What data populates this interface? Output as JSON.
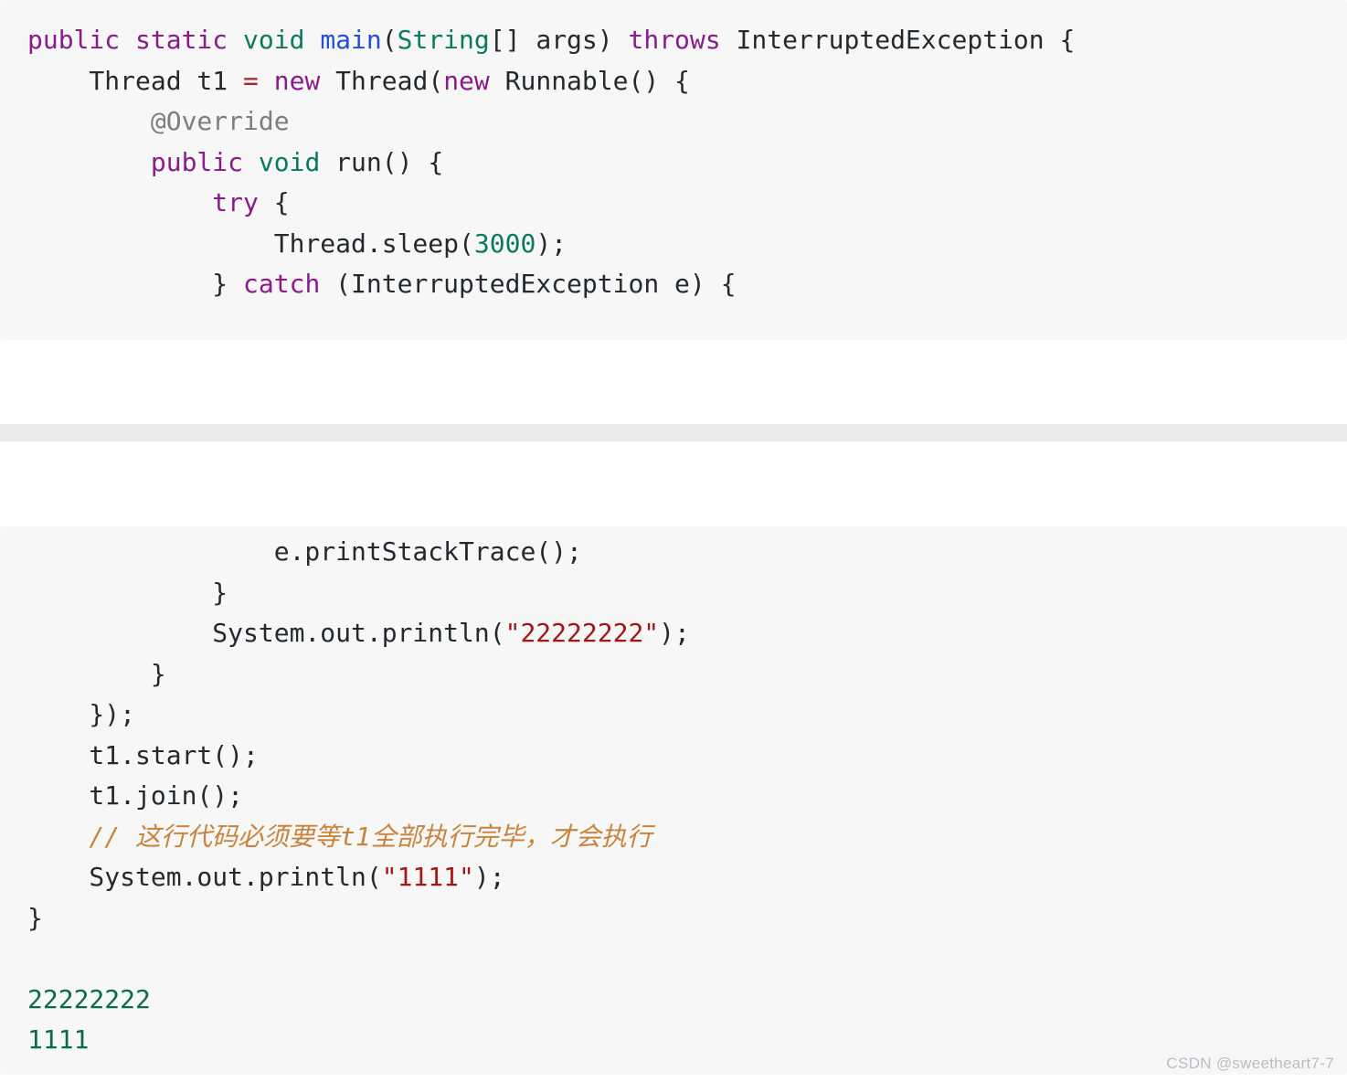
{
  "page": {
    "language": "java",
    "background": "#ffffff",
    "code_block_background": "#f7f7f7",
    "divider_background": "#ebebeb"
  },
  "colors": {
    "keyword": "#8b1a8b",
    "type": "#0a7a5e",
    "function": "#2050d8",
    "operator": "#a4262c",
    "annotation": "#7d7d7d",
    "string": "#a41515",
    "comment": "#c8843c",
    "plain": "#24292e",
    "output": "#0a6b4a",
    "watermark": "#b9bdc2"
  },
  "block_one": {
    "lines": [
      {
        "tokens": [
          {
            "t": "public static ",
            "c": "kw"
          },
          {
            "t": "void ",
            "c": "typ"
          },
          {
            "t": "main",
            "c": "fn"
          },
          {
            "t": "(",
            "c": "plain"
          },
          {
            "t": "String",
            "c": "typ"
          },
          {
            "t": "[] args) ",
            "c": "plain"
          },
          {
            "t": "throws ",
            "c": "kw"
          },
          {
            "t": "InterruptedException {",
            "c": "plain"
          }
        ]
      },
      {
        "tokens": [
          {
            "t": "    Thread t1 ",
            "c": "plain"
          },
          {
            "t": "=",
            "c": "op"
          },
          {
            "t": " ",
            "c": "plain"
          },
          {
            "t": "new ",
            "c": "kw"
          },
          {
            "t": "Thread(",
            "c": "plain"
          },
          {
            "t": "new ",
            "c": "kw"
          },
          {
            "t": "Runnable() {",
            "c": "plain"
          }
        ]
      },
      {
        "tokens": [
          {
            "t": "        @Override",
            "c": "ann"
          }
        ]
      },
      {
        "tokens": [
          {
            "t": "        ",
            "c": "plain"
          },
          {
            "t": "public ",
            "c": "kw"
          },
          {
            "t": "void ",
            "c": "typ"
          },
          {
            "t": "run() {",
            "c": "plain"
          }
        ]
      },
      {
        "tokens": [
          {
            "t": "            ",
            "c": "plain"
          },
          {
            "t": "try",
            "c": "kw"
          },
          {
            "t": " {",
            "c": "plain"
          }
        ]
      },
      {
        "tokens": [
          {
            "t": "                Thread.sleep(",
            "c": "plain"
          },
          {
            "t": "3000",
            "c": "num"
          },
          {
            "t": ");",
            "c": "plain"
          }
        ]
      },
      {
        "tokens": [
          {
            "t": "            } ",
            "c": "plain"
          },
          {
            "t": "catch",
            "c": "kw"
          },
          {
            "t": " (InterruptedException e) {",
            "c": "plain"
          }
        ]
      }
    ]
  },
  "block_two": {
    "lines": [
      {
        "tokens": [
          {
            "t": "                e.printStackTrace();",
            "c": "plain"
          }
        ]
      },
      {
        "tokens": [
          {
            "t": "            }",
            "c": "plain"
          }
        ]
      },
      {
        "tokens": [
          {
            "t": "            System.out.println(",
            "c": "plain"
          },
          {
            "t": "\"22222222\"",
            "c": "str"
          },
          {
            "t": ");",
            "c": "plain"
          }
        ]
      },
      {
        "tokens": [
          {
            "t": "        }",
            "c": "plain"
          }
        ]
      },
      {
        "tokens": [
          {
            "t": "    });",
            "c": "plain"
          }
        ]
      },
      {
        "tokens": [
          {
            "t": "    t1.start();",
            "c": "plain"
          }
        ]
      },
      {
        "tokens": [
          {
            "t": "    t1.join();",
            "c": "plain"
          }
        ]
      },
      {
        "tokens": [
          {
            "t": "    // 这行代码必须要等t1全部执行完毕，才会执行",
            "c": "cmt"
          }
        ]
      },
      {
        "tokens": [
          {
            "t": "    System.out.println(",
            "c": "plain"
          },
          {
            "t": "\"1111\"",
            "c": "str"
          },
          {
            "t": ");",
            "c": "plain"
          }
        ]
      },
      {
        "tokens": [
          {
            "t": "}",
            "c": "plain"
          }
        ]
      },
      {
        "blank": true
      },
      {
        "tokens": [
          {
            "t": "22222222",
            "c": "outv"
          }
        ]
      },
      {
        "tokens": [
          {
            "t": "1111",
            "c": "outv"
          }
        ]
      }
    ]
  },
  "watermark": {
    "text": "CSDN @sweetheart7-7"
  }
}
